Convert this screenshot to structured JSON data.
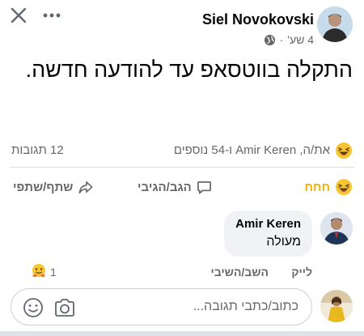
{
  "header": {
    "close_icon": "close-icon",
    "more_icon": "more-options-icon"
  },
  "post": {
    "author": "Siel Novokovski",
    "time": "4 שע'",
    "separator": "·",
    "privacy_icon": "globe-icon",
    "text": "התקלה בווטסאפ עד להודעה חדשה."
  },
  "reactions": {
    "emoji": "haha-emoji-icon",
    "summary": "את/ה, Amir Keren ו-54 נוספים",
    "comments_count": "12 תגובות"
  },
  "actions": {
    "haha_label": "חחח",
    "comment_label": "הגב/הגיבי",
    "share_label": "שתף/שתפי"
  },
  "comment": {
    "author": "Amir Keren",
    "text": "מעולה",
    "like_label": "לייק",
    "reply_label": "השב/השיבי",
    "reaction_count": "1",
    "reaction_emoji": "hug-emoji-icon"
  },
  "composer": {
    "placeholder": "כתוב/כתבי תגובה..."
  },
  "colors": {
    "haha_accent": "#f0b100",
    "secondary_text": "#65676b",
    "bubble_bg": "#f0f2f5"
  }
}
